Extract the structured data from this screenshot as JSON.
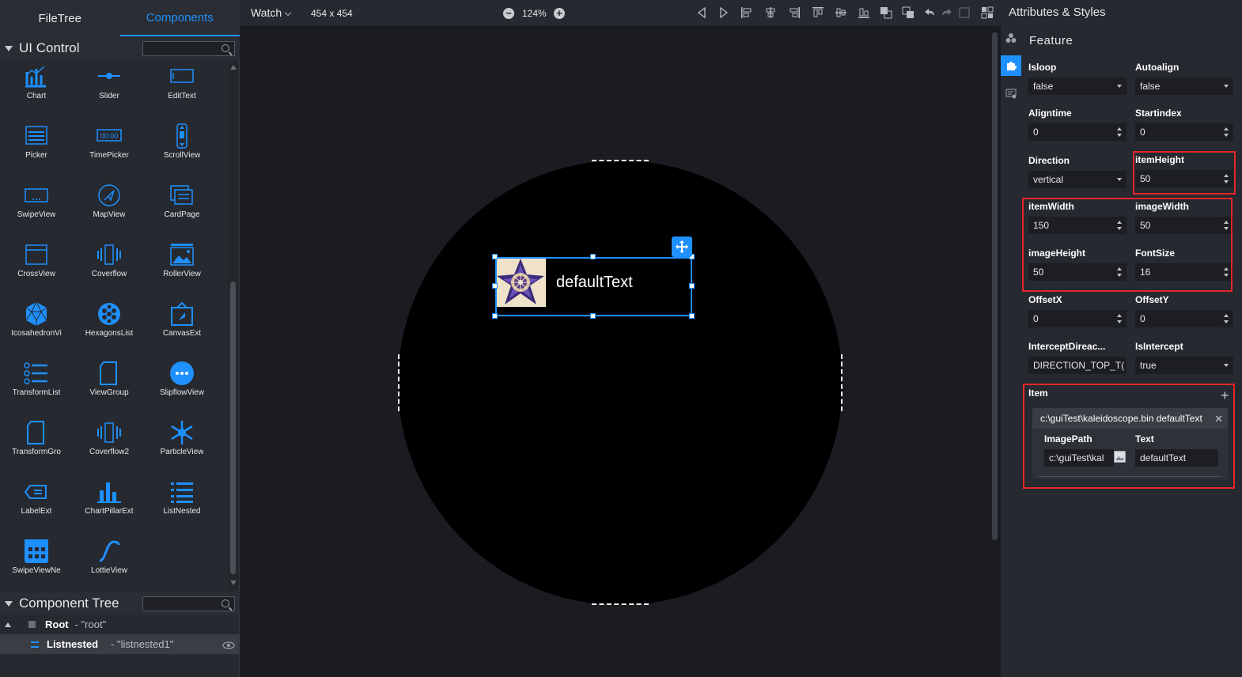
{
  "left_tabs": [
    "FileTree",
    "Components"
  ],
  "ui_control": {
    "title": "UI Control"
  },
  "palette": [
    {
      "label": "Chart",
      "icon": "chart-icon"
    },
    {
      "label": "Slider",
      "icon": "slider-icon"
    },
    {
      "label": "EditText",
      "icon": "edittext-icon"
    },
    {
      "label": "Picker",
      "icon": "picker-icon"
    },
    {
      "label": "TimePicker",
      "icon": "timepicker-icon"
    },
    {
      "label": "ScrollView",
      "icon": "scrollview-icon"
    },
    {
      "label": "SwipeView",
      "icon": "swipeview-icon"
    },
    {
      "label": "MapView",
      "icon": "mapview-icon"
    },
    {
      "label": "CardPage",
      "icon": "cardpage-icon"
    },
    {
      "label": "CrossView",
      "icon": "crossview-icon"
    },
    {
      "label": "Coverflow",
      "icon": "coverflow-icon"
    },
    {
      "label": "RollerView",
      "icon": "rollerview-icon"
    },
    {
      "label": "IcosahedronVi",
      "icon": "icosahedron-icon"
    },
    {
      "label": "HexagonsList",
      "icon": "hexagons-icon"
    },
    {
      "label": "CanvasExt",
      "icon": "canvasext-icon"
    },
    {
      "label": "TransformList",
      "icon": "transformlist-icon"
    },
    {
      "label": "ViewGroup",
      "icon": "viewgroup-icon"
    },
    {
      "label": "SlipflowView",
      "icon": "slipflow-icon"
    },
    {
      "label": "TransformGro",
      "icon": "transformgroup-icon"
    },
    {
      "label": "Coverflow2",
      "icon": "coverflow2-icon"
    },
    {
      "label": "ParticleView",
      "icon": "particle-icon"
    },
    {
      "label": "LabelExt",
      "icon": "labelext-icon"
    },
    {
      "label": "ChartPillarExt",
      "icon": "chartpillar-icon"
    },
    {
      "label": "ListNested",
      "icon": "listnested-icon"
    },
    {
      "label": "SwipeViewNe",
      "icon": "swipeviewnested-icon"
    },
    {
      "label": "LottieView",
      "icon": "lottie-icon"
    }
  ],
  "component_tree": {
    "title": "Component Tree",
    "rows": [
      {
        "name": "Root",
        "id": "- \"root\""
      },
      {
        "name": "Listnested",
        "id": "- \"listnested1\""
      }
    ]
  },
  "toolbar": {
    "watch": "Watch",
    "dims": "454 x 454",
    "zoom": "124%"
  },
  "right_title": "Attributes & Styles",
  "canvas": {
    "text": "defaultText"
  },
  "props": {
    "section": "Feature",
    "isloop": {
      "label": "Isloop",
      "value": "false"
    },
    "autoalign": {
      "label": "Autoalign",
      "value": "false"
    },
    "aligntime": {
      "label": "Aligntime",
      "value": "0"
    },
    "startindex": {
      "label": "Startindex",
      "value": "0"
    },
    "direction": {
      "label": "Direction",
      "value": "vertical"
    },
    "itemheight": {
      "label": "itemHeight",
      "value": "50"
    },
    "itemwidth": {
      "label": "itemWidth",
      "value": "150"
    },
    "imagewidth": {
      "label": "imageWidth",
      "value": "50"
    },
    "imageheight": {
      "label": "imageHeight",
      "value": "50"
    },
    "fontsize": {
      "label": "FontSize",
      "value": "16"
    },
    "offsetx": {
      "label": "OffsetX",
      "value": "0"
    },
    "offsety": {
      "label": "OffsetY",
      "value": "0"
    },
    "intercept_dir": {
      "label": "InterceptDireac...",
      "value": "DIRECTION_TOP_T("
    },
    "isintercept": {
      "label": "IsIntercept",
      "value": "true"
    },
    "item": {
      "label": "Item",
      "header": "c:\\guiTest\\kaleidoscope.bin defaultText",
      "imagepath_label": "ImagePath",
      "imagepath_value": "c:\\guiTest\\kal",
      "text_label": "Text",
      "text_value": "defaultText"
    }
  },
  "colors": {
    "accent": "#1e90ff",
    "highlight": "#e5252a"
  }
}
